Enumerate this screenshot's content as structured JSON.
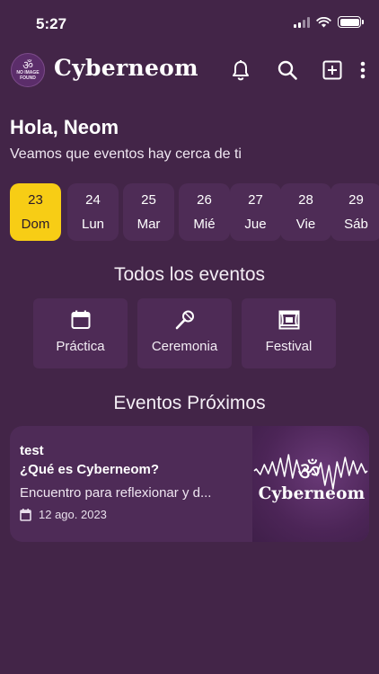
{
  "status_bar": {
    "time": "5:27"
  },
  "app": {
    "title": "Cyberneom",
    "logo_text_line1": "NO IMAGE",
    "logo_text_line2": "FOUND",
    "actions": [
      "bell-icon",
      "search-icon",
      "add-box-icon",
      "more-vert-icon"
    ]
  },
  "greeting": {
    "title": "Hola, Neom",
    "subtitle": "Veamos que eventos hay cerca de ti"
  },
  "days": [
    {
      "number": "23",
      "name": "Dom",
      "selected": true
    },
    {
      "number": "24",
      "name": "Lun",
      "selected": false
    },
    {
      "number": "25",
      "name": "Mar",
      "selected": false
    },
    {
      "number": "26",
      "name": "Mié",
      "selected": false
    },
    {
      "number": "27",
      "name": "Jue",
      "selected": false
    },
    {
      "number": "28",
      "name": "Vie",
      "selected": false
    },
    {
      "number": "29",
      "name": "Sáb",
      "selected": false
    }
  ],
  "sections": {
    "all_events": "Todos los eventos",
    "upcoming": "Eventos Próximos"
  },
  "categories": [
    {
      "label": "Práctica",
      "icon": "calendar-icon"
    },
    {
      "label": "Ceremonia",
      "icon": "microphone-icon"
    },
    {
      "label": "Festival",
      "icon": "stage-icon"
    }
  ],
  "event": {
    "title": "test",
    "subtitle": "¿Qué es Cyberneom?",
    "description": "Encuentro para reflexionar y d...",
    "date": "12 ago. 2023",
    "image_title": "Cyberneom",
    "image_symbol": "ॐ"
  },
  "colors": {
    "background": "#432548",
    "card": "#4e2b57",
    "accent_selected": "#f7cd15"
  }
}
